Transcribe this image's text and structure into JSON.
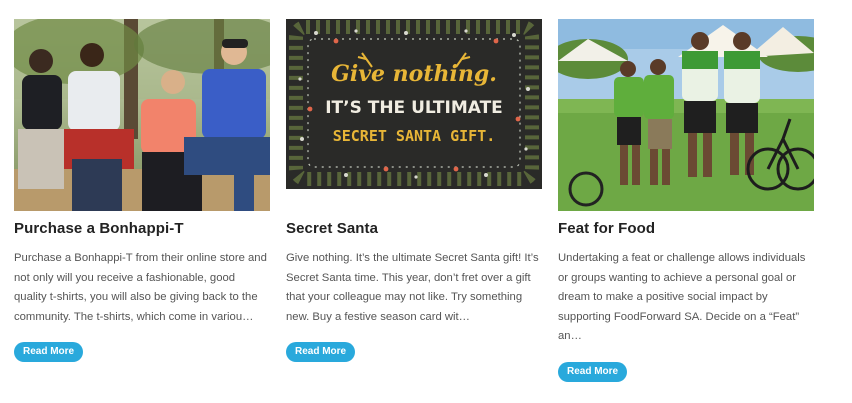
{
  "cards": [
    {
      "title": "Purchase a Bonhappi-T",
      "excerpt": "Purchase a Bonhappi-T from their online store and not only will you receive a fashionable, good quality t-shirts, you will also be giving back to the community. The t-shirts, which come in variou…",
      "button": "Read More",
      "image_alt": "Four young people wearing Bonhappi t-shirts sitting outdoors"
    },
    {
      "title": "Secret Santa",
      "excerpt": "Give nothing. It’s the ultimate Secret Santa gift! It’s Secret Santa time. This year, don’t fret over a gift that your colleague may not like. Try something new. Buy a festive season card wit…",
      "button": "Read More",
      "image_text": {
        "line1": "Give nothing.",
        "line2": "IT’S THE ULTIMATE",
        "line3": "SECRET SANTA GIFT."
      }
    },
    {
      "title": "Feat for Food",
      "excerpt": "Undertaking a feat or challenge allows individuals or groups wanting to achieve a personal goal or dream to make a positive social impact by supporting FoodForward SA. Decide on a “Feat” an…",
      "button": "Read More",
      "image_alt": "Group of cyclists in green jerseys posing on grass"
    }
  ],
  "colors": {
    "button_bg": "#29a9dc",
    "title": "#222222",
    "text": "#555555",
    "chalkboard": "#2a2a28",
    "gold": "#e8b637"
  }
}
